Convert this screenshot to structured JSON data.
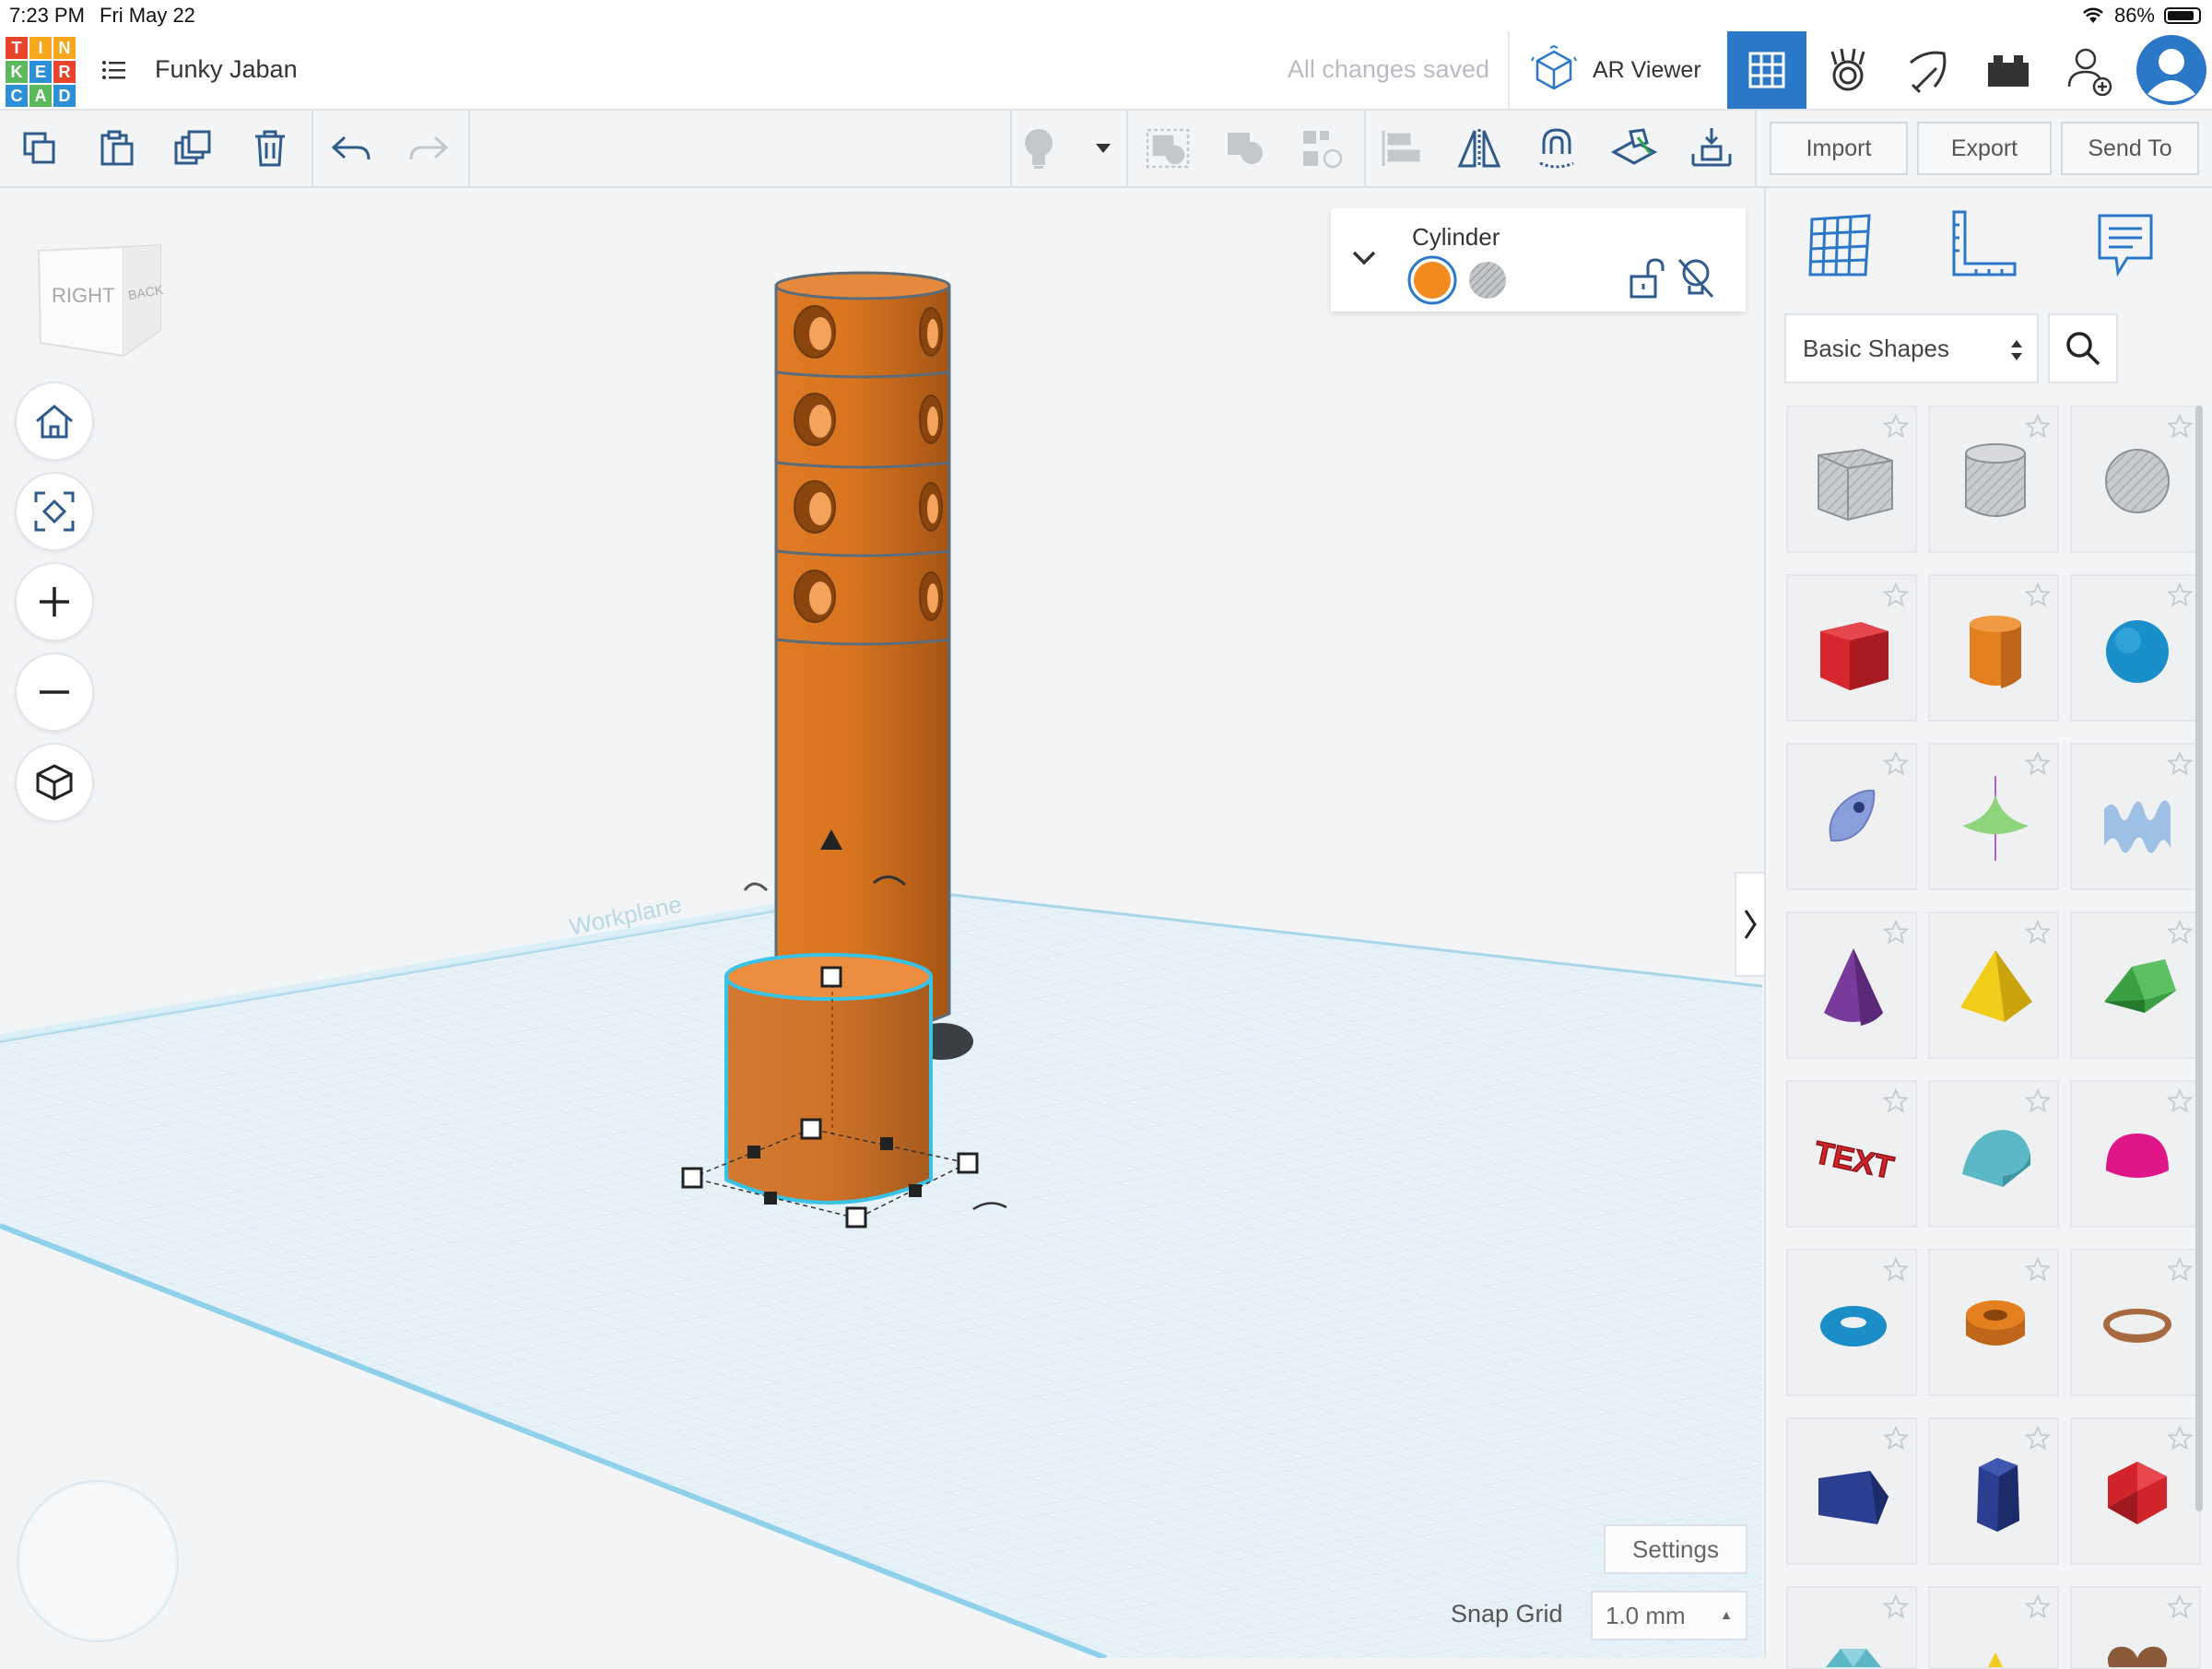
{
  "status_bar": {
    "time": "7:23 PM",
    "date": "Fri May 22",
    "battery": "86%",
    "battery_level": 0.86
  },
  "header": {
    "logo_letters": [
      "T",
      "I",
      "N",
      "K",
      "E",
      "R",
      "C",
      "A",
      "D"
    ],
    "logo_colors": [
      "#e8452c",
      "#f7a71b",
      "#f7a71b",
      "#5cb85c",
      "#2d8fd5",
      "#e8452c",
      "#2d8fd5",
      "#5cb85c",
      "#2d8fd5"
    ],
    "title": "Funky Jaban",
    "save_status": "All changes saved",
    "ar_viewer_label": "AR Viewer",
    "accent": "#2b78c8"
  },
  "toolbar": {
    "import_label": "Import",
    "export_label": "Export",
    "send_to_label": "Send To"
  },
  "viewcube": {
    "right_label": "RIGHT",
    "back_label": "BACK"
  },
  "inspector": {
    "shape_name": "Cylinder",
    "solid_color": "#f28a1e"
  },
  "workplane": {
    "label": "Workplane"
  },
  "right_panel": {
    "category": "Basic Shapes",
    "shapes": [
      {
        "name": "Box Hole",
        "icon": "box-hole-icon",
        "color": "#b9bcc0"
      },
      {
        "name": "Cylinder Hole",
        "icon": "cylinder-hole-icon",
        "color": "#b9bcc0"
      },
      {
        "name": "Sphere Hole",
        "icon": "sphere-hole-icon",
        "color": "#b9bcc0"
      },
      {
        "name": "Box",
        "icon": "box-icon",
        "color": "#d7262d"
      },
      {
        "name": "Cylinder",
        "icon": "cylinder-icon",
        "color": "#e5801f"
      },
      {
        "name": "Sphere",
        "icon": "sphere-icon",
        "color": "#1a8fc9"
      },
      {
        "name": "Scribble",
        "icon": "scribble-icon",
        "color": "#8b9edc"
      },
      {
        "name": "Shape Generator",
        "icon": "spin-top-icon",
        "color": "#8ed47a"
      },
      {
        "name": "Wave",
        "icon": "wave-icon",
        "color": "#9ec0e4"
      },
      {
        "name": "Cone",
        "icon": "cone-icon",
        "color": "#7a3c9c"
      },
      {
        "name": "Pyramid",
        "icon": "pyramid-icon",
        "color": "#f2cc1a"
      },
      {
        "name": "Roof",
        "icon": "roof-icon",
        "color": "#3aa043"
      },
      {
        "name": "Text",
        "icon": "text-icon",
        "color": "#d1242b"
      },
      {
        "name": "Round Roof",
        "icon": "round-roof-icon",
        "color": "#5cb8c6"
      },
      {
        "name": "Half Sphere",
        "icon": "half-sphere-icon",
        "color": "#e0158a"
      },
      {
        "name": "Torus",
        "icon": "torus-icon",
        "color": "#1b8ec7"
      },
      {
        "name": "Tube",
        "icon": "tube-icon",
        "color": "#e5801f"
      },
      {
        "name": "Ring",
        "icon": "ring-icon",
        "color": "#a76a3f"
      },
      {
        "name": "Wedge",
        "icon": "wedge-icon",
        "color": "#2b3e8f"
      },
      {
        "name": "Polygon",
        "icon": "polygon-icon",
        "color": "#2b3e8f"
      },
      {
        "name": "Icosahedron",
        "icon": "icosahedron-icon",
        "color": "#d1242b"
      },
      {
        "name": "Diamond",
        "icon": "diamond-icon",
        "color": "#5cb8c6"
      },
      {
        "name": "Star",
        "icon": "star-shape-icon",
        "color": "#f2cc1a"
      },
      {
        "name": "Heart",
        "icon": "heart-icon",
        "color": "#8a5a3b"
      }
    ]
  },
  "bottom": {
    "settings_label": "Settings",
    "snap_grid_label": "Snap Grid",
    "snap_grid_value": "1.0 mm"
  }
}
